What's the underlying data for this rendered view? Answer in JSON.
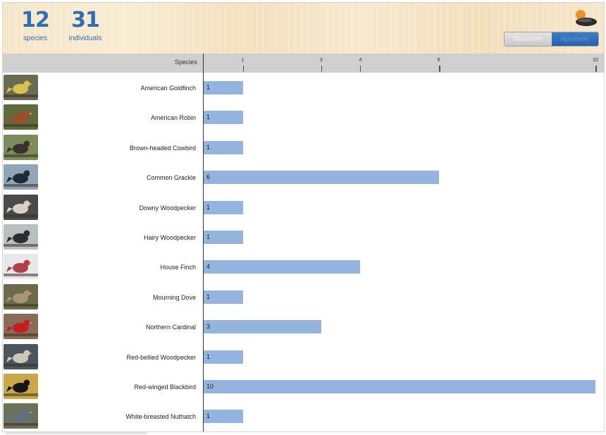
{
  "summary": {
    "species_count": "12",
    "species_label": "species",
    "individuals_count": "31",
    "individuals_label": "individuals"
  },
  "sort_toggle": {
    "options": [
      "Taxonomic",
      "Alphabetic"
    ],
    "selected": "Alphabetic"
  },
  "colors": {
    "accent": "#2f6db5",
    "bar": "#94b3df",
    "header_bar": "#cfcfcf"
  },
  "chart_data": {
    "type": "bar",
    "orientation": "horizontal",
    "category_header": "Species",
    "categories": [
      "American Goldfinch",
      "American Robin",
      "Brown-headed Cowbird",
      "Common Grackle",
      "Downy Woodpecker",
      "Hairy Woodpecker",
      "House Finch",
      "Mourning Dove",
      "Northern Cardinal",
      "Red-bellied Woodpecker",
      "Red-winged Blackbird",
      "White-breasted Nuthatch"
    ],
    "values": [
      1,
      1,
      1,
      6,
      1,
      1,
      4,
      1,
      3,
      1,
      10,
      1
    ],
    "ticks": [
      1,
      3,
      4,
      6,
      10
    ],
    "xlim": [
      0,
      10
    ],
    "grid": false
  },
  "thumbnails": [
    {
      "icon": "american-goldfinch-photo",
      "bg": "#6b6b55",
      "bird": "#d8c24a"
    },
    {
      "icon": "american-robin-photo",
      "bg": "#5d6b3e",
      "bird": "#a14b2a"
    },
    {
      "icon": "brown-headed-cowbird-photo",
      "bg": "#7a8c5a",
      "bird": "#3a3030"
    },
    {
      "icon": "common-grackle-photo",
      "bg": "#8fa6b8",
      "bird": "#1e2a3a"
    },
    {
      "icon": "downy-woodpecker-photo",
      "bg": "#4a4a48",
      "bird": "#d9d2c4"
    },
    {
      "icon": "hairy-woodpecker-photo",
      "bg": "#b8c0c0",
      "bird": "#2d2d2d"
    },
    {
      "icon": "house-finch-photo",
      "bg": "#e8e8ec",
      "bird": "#b0404a"
    },
    {
      "icon": "mourning-dove-photo",
      "bg": "#6b6a4a",
      "bird": "#a89477"
    },
    {
      "icon": "northern-cardinal-photo",
      "bg": "#8a6a58",
      "bird": "#c41e1e"
    },
    {
      "icon": "red-bellied-woodpecker-photo",
      "bg": "#4a5560",
      "bird": "#cfc7b8"
    },
    {
      "icon": "red-winged-blackbird-photo",
      "bg": "#c9a84a",
      "bird": "#151515"
    },
    {
      "icon": "white-breasted-nuthatch-photo",
      "bg": "#6a705a",
      "bird": "#5f7080"
    }
  ]
}
